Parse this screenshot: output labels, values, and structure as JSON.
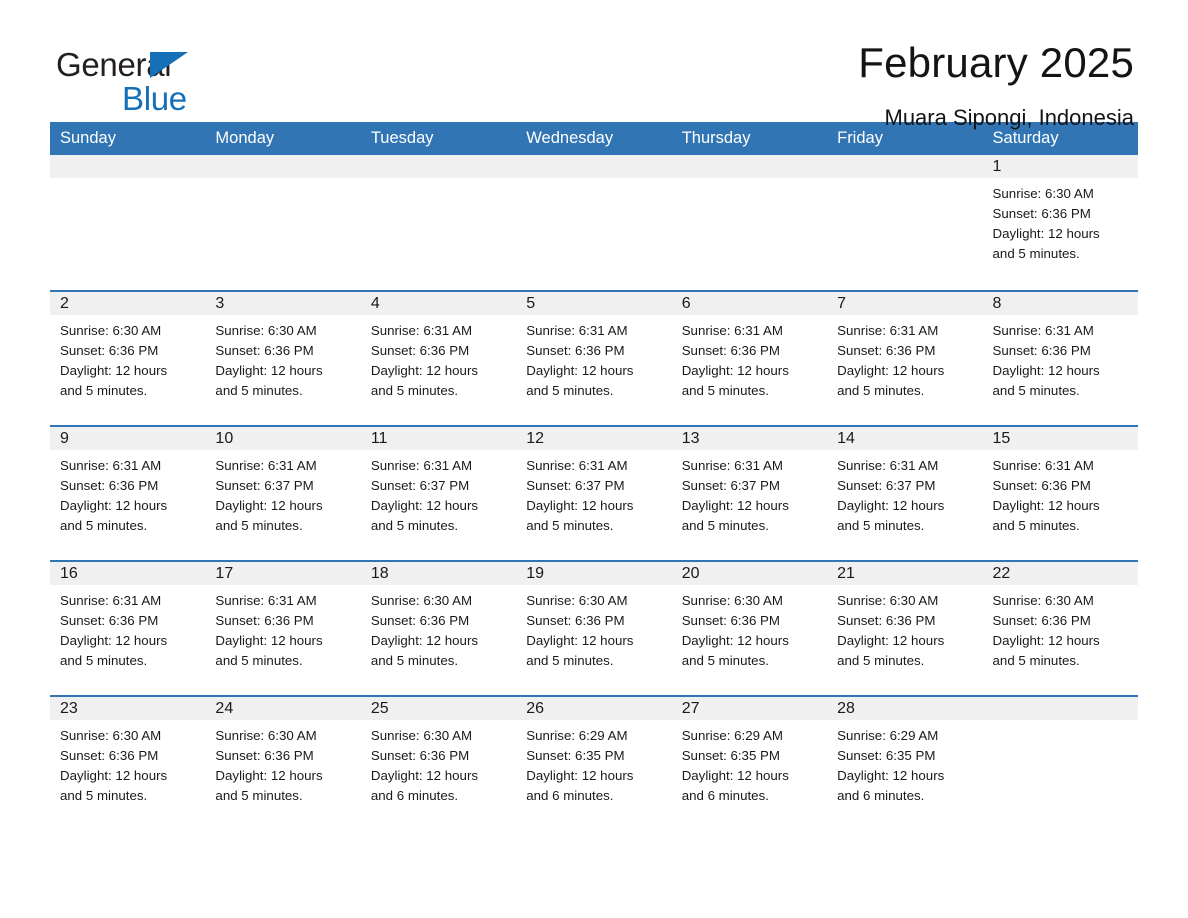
{
  "brand": {
    "word1": "General",
    "word2": "Blue",
    "triangle_color": "#1570b8",
    "text_color": "#231f20"
  },
  "header": {
    "month_title": "February 2025",
    "location": "Muara Sipongi, Indonesia"
  },
  "theme": {
    "header_blue": "#3175b5",
    "rule_blue": "#3175b5",
    "daynum_band": "#f0f0f0",
    "text": "#1a1a1a"
  },
  "weekdays": [
    "Sunday",
    "Monday",
    "Tuesday",
    "Wednesday",
    "Thursday",
    "Friday",
    "Saturday"
  ],
  "weeks": [
    [
      {
        "day": "",
        "sunrise": "",
        "sunset": "",
        "daylight1": "",
        "daylight2": ""
      },
      {
        "day": "",
        "sunrise": "",
        "sunset": "",
        "daylight1": "",
        "daylight2": ""
      },
      {
        "day": "",
        "sunrise": "",
        "sunset": "",
        "daylight1": "",
        "daylight2": ""
      },
      {
        "day": "",
        "sunrise": "",
        "sunset": "",
        "daylight1": "",
        "daylight2": ""
      },
      {
        "day": "",
        "sunrise": "",
        "sunset": "",
        "daylight1": "",
        "daylight2": ""
      },
      {
        "day": "",
        "sunrise": "",
        "sunset": "",
        "daylight1": "",
        "daylight2": ""
      },
      {
        "day": "1",
        "sunrise": "Sunrise: 6:30 AM",
        "sunset": "Sunset: 6:36 PM",
        "daylight1": "Daylight: 12 hours",
        "daylight2": "and 5 minutes."
      }
    ],
    [
      {
        "day": "2",
        "sunrise": "Sunrise: 6:30 AM",
        "sunset": "Sunset: 6:36 PM",
        "daylight1": "Daylight: 12 hours",
        "daylight2": "and 5 minutes."
      },
      {
        "day": "3",
        "sunrise": "Sunrise: 6:30 AM",
        "sunset": "Sunset: 6:36 PM",
        "daylight1": "Daylight: 12 hours",
        "daylight2": "and 5 minutes."
      },
      {
        "day": "4",
        "sunrise": "Sunrise: 6:31 AM",
        "sunset": "Sunset: 6:36 PM",
        "daylight1": "Daylight: 12 hours",
        "daylight2": "and 5 minutes."
      },
      {
        "day": "5",
        "sunrise": "Sunrise: 6:31 AM",
        "sunset": "Sunset: 6:36 PM",
        "daylight1": "Daylight: 12 hours",
        "daylight2": "and 5 minutes."
      },
      {
        "day": "6",
        "sunrise": "Sunrise: 6:31 AM",
        "sunset": "Sunset: 6:36 PM",
        "daylight1": "Daylight: 12 hours",
        "daylight2": "and 5 minutes."
      },
      {
        "day": "7",
        "sunrise": "Sunrise: 6:31 AM",
        "sunset": "Sunset: 6:36 PM",
        "daylight1": "Daylight: 12 hours",
        "daylight2": "and 5 minutes."
      },
      {
        "day": "8",
        "sunrise": "Sunrise: 6:31 AM",
        "sunset": "Sunset: 6:36 PM",
        "daylight1": "Daylight: 12 hours",
        "daylight2": "and 5 minutes."
      }
    ],
    [
      {
        "day": "9",
        "sunrise": "Sunrise: 6:31 AM",
        "sunset": "Sunset: 6:36 PM",
        "daylight1": "Daylight: 12 hours",
        "daylight2": "and 5 minutes."
      },
      {
        "day": "10",
        "sunrise": "Sunrise: 6:31 AM",
        "sunset": "Sunset: 6:37 PM",
        "daylight1": "Daylight: 12 hours",
        "daylight2": "and 5 minutes."
      },
      {
        "day": "11",
        "sunrise": "Sunrise: 6:31 AM",
        "sunset": "Sunset: 6:37 PM",
        "daylight1": "Daylight: 12 hours",
        "daylight2": "and 5 minutes."
      },
      {
        "day": "12",
        "sunrise": "Sunrise: 6:31 AM",
        "sunset": "Sunset: 6:37 PM",
        "daylight1": "Daylight: 12 hours",
        "daylight2": "and 5 minutes."
      },
      {
        "day": "13",
        "sunrise": "Sunrise: 6:31 AM",
        "sunset": "Sunset: 6:37 PM",
        "daylight1": "Daylight: 12 hours",
        "daylight2": "and 5 minutes."
      },
      {
        "day": "14",
        "sunrise": "Sunrise: 6:31 AM",
        "sunset": "Sunset: 6:37 PM",
        "daylight1": "Daylight: 12 hours",
        "daylight2": "and 5 minutes."
      },
      {
        "day": "15",
        "sunrise": "Sunrise: 6:31 AM",
        "sunset": "Sunset: 6:36 PM",
        "daylight1": "Daylight: 12 hours",
        "daylight2": "and 5 minutes."
      }
    ],
    [
      {
        "day": "16",
        "sunrise": "Sunrise: 6:31 AM",
        "sunset": "Sunset: 6:36 PM",
        "daylight1": "Daylight: 12 hours",
        "daylight2": "and 5 minutes."
      },
      {
        "day": "17",
        "sunrise": "Sunrise: 6:31 AM",
        "sunset": "Sunset: 6:36 PM",
        "daylight1": "Daylight: 12 hours",
        "daylight2": "and 5 minutes."
      },
      {
        "day": "18",
        "sunrise": "Sunrise: 6:30 AM",
        "sunset": "Sunset: 6:36 PM",
        "daylight1": "Daylight: 12 hours",
        "daylight2": "and 5 minutes."
      },
      {
        "day": "19",
        "sunrise": "Sunrise: 6:30 AM",
        "sunset": "Sunset: 6:36 PM",
        "daylight1": "Daylight: 12 hours",
        "daylight2": "and 5 minutes."
      },
      {
        "day": "20",
        "sunrise": "Sunrise: 6:30 AM",
        "sunset": "Sunset: 6:36 PM",
        "daylight1": "Daylight: 12 hours",
        "daylight2": "and 5 minutes."
      },
      {
        "day": "21",
        "sunrise": "Sunrise: 6:30 AM",
        "sunset": "Sunset: 6:36 PM",
        "daylight1": "Daylight: 12 hours",
        "daylight2": "and 5 minutes."
      },
      {
        "day": "22",
        "sunrise": "Sunrise: 6:30 AM",
        "sunset": "Sunset: 6:36 PM",
        "daylight1": "Daylight: 12 hours",
        "daylight2": "and 5 minutes."
      }
    ],
    [
      {
        "day": "23",
        "sunrise": "Sunrise: 6:30 AM",
        "sunset": "Sunset: 6:36 PM",
        "daylight1": "Daylight: 12 hours",
        "daylight2": "and 5 minutes."
      },
      {
        "day": "24",
        "sunrise": "Sunrise: 6:30 AM",
        "sunset": "Sunset: 6:36 PM",
        "daylight1": "Daylight: 12 hours",
        "daylight2": "and 5 minutes."
      },
      {
        "day": "25",
        "sunrise": "Sunrise: 6:30 AM",
        "sunset": "Sunset: 6:36 PM",
        "daylight1": "Daylight: 12 hours",
        "daylight2": "and 6 minutes."
      },
      {
        "day": "26",
        "sunrise": "Sunrise: 6:29 AM",
        "sunset": "Sunset: 6:35 PM",
        "daylight1": "Daylight: 12 hours",
        "daylight2": "and 6 minutes."
      },
      {
        "day": "27",
        "sunrise": "Sunrise: 6:29 AM",
        "sunset": "Sunset: 6:35 PM",
        "daylight1": "Daylight: 12 hours",
        "daylight2": "and 6 minutes."
      },
      {
        "day": "28",
        "sunrise": "Sunrise: 6:29 AM",
        "sunset": "Sunset: 6:35 PM",
        "daylight1": "Daylight: 12 hours",
        "daylight2": "and 6 minutes."
      },
      {
        "day": "",
        "sunrise": "",
        "sunset": "",
        "daylight1": "",
        "daylight2": ""
      }
    ]
  ]
}
